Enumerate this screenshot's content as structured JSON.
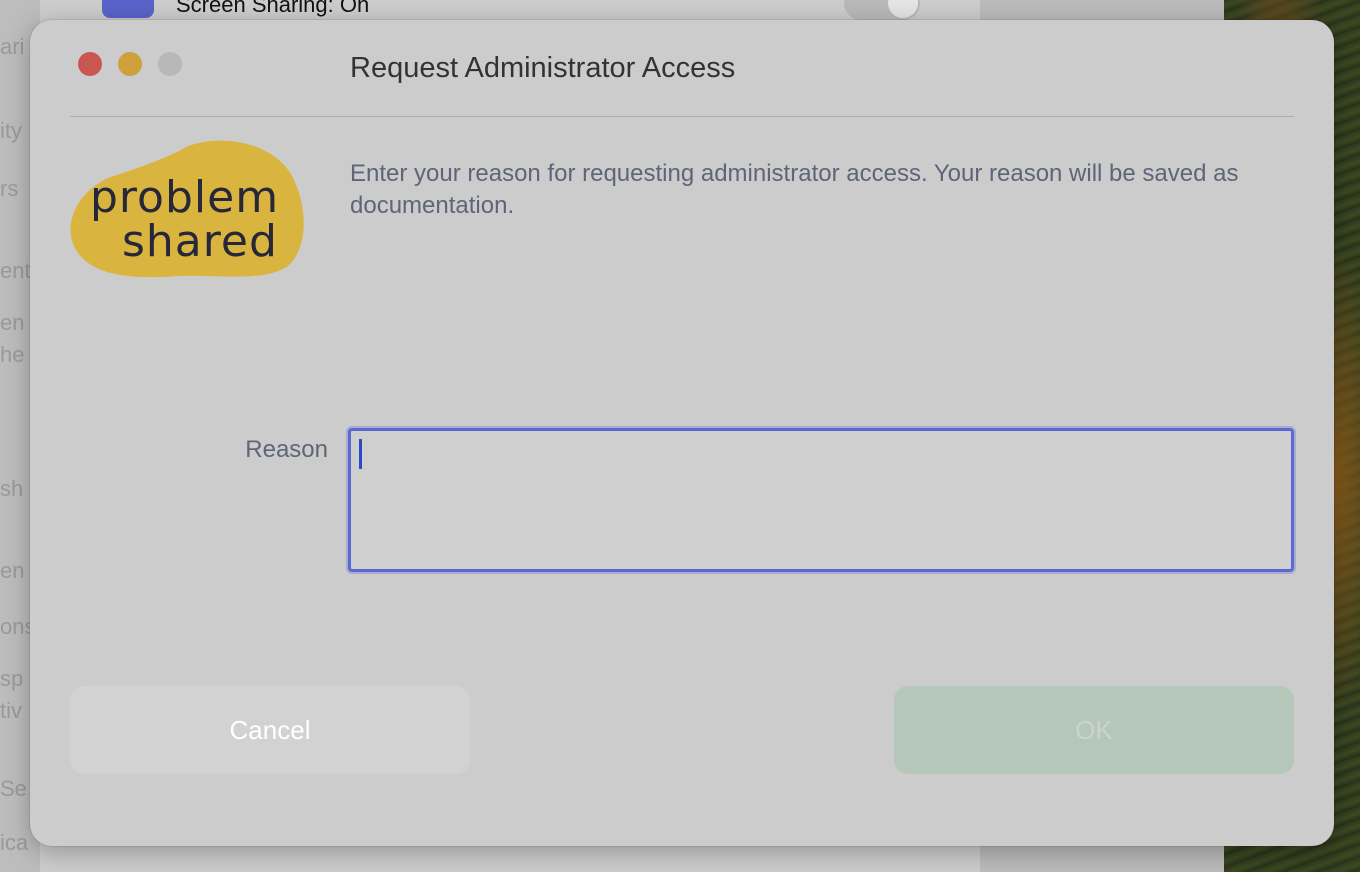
{
  "background": {
    "title": "Screen Sharing: On",
    "side_fragments": [
      "ari",
      "ity",
      "rs",
      "ent",
      "en",
      "he",
      "sh",
      "en",
      "ons",
      "sp",
      "tiv",
      "Se",
      "ica"
    ]
  },
  "dialog": {
    "title": "Request Administrator Access",
    "logo": {
      "line1": "problem",
      "line2": "shared",
      "blob_color": "#d9b43f"
    },
    "description": "Enter your reason for requesting administrator access. Your reason will be saved as documentation.",
    "reason_label": "Reason",
    "reason_value": "",
    "cancel_label": "Cancel",
    "ok_label": "OK"
  },
  "colors": {
    "accent": "#5b6ad0",
    "close": "#c95650",
    "minimize": "#cfa03b",
    "ok_button": "#b5c7b8"
  }
}
